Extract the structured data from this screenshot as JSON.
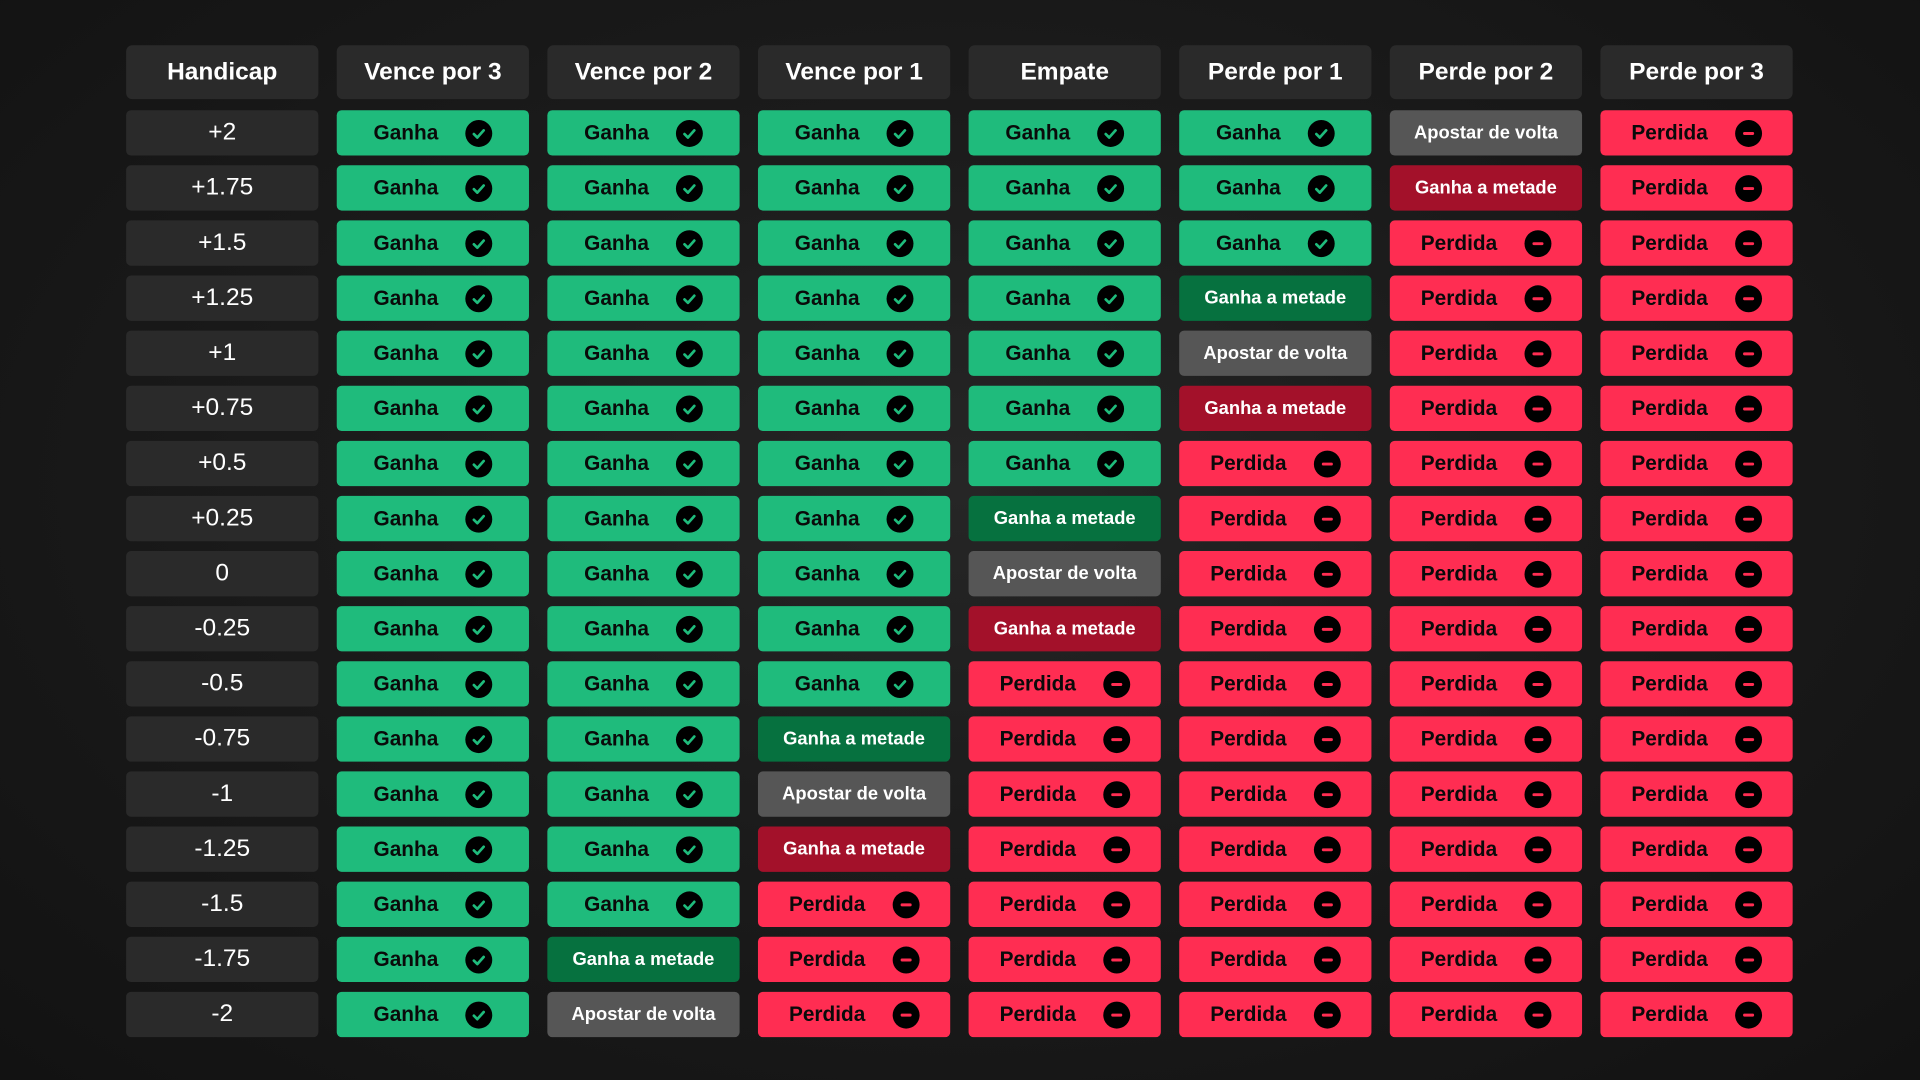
{
  "headers": [
    "Handicap",
    "Vence por 3",
    "Vence por 2",
    "Vence por 1",
    "Empate",
    "Perde por 1",
    "Perde por 2",
    "Perde por 3"
  ],
  "labels": {
    "W": "Ganha",
    "L": "Perdida",
    "HG": "Ganha a metade",
    "HR": "Ganha a metade",
    "P": "Apostar de volta"
  },
  "icons": {
    "W": "check-circle-icon",
    "L": "minus-circle-icon"
  },
  "colors": {
    "win": "#1fbb7c",
    "loss": "#ff2d52",
    "half_win": "#06713f",
    "half_red": "#a3112a",
    "push": "#565656",
    "cell_bg": "#2a2a2a",
    "background": "#151515"
  },
  "rows": [
    {
      "handicap": "+2",
      "results": [
        "W",
        "W",
        "W",
        "W",
        "W",
        "P",
        "L"
      ]
    },
    {
      "handicap": "+1.75",
      "results": [
        "W",
        "W",
        "W",
        "W",
        "W",
        "HR",
        "L"
      ]
    },
    {
      "handicap": "+1.5",
      "results": [
        "W",
        "W",
        "W",
        "W",
        "W",
        "L",
        "L"
      ]
    },
    {
      "handicap": "+1.25",
      "results": [
        "W",
        "W",
        "W",
        "W",
        "HG",
        "L",
        "L"
      ]
    },
    {
      "handicap": "+1",
      "results": [
        "W",
        "W",
        "W",
        "W",
        "P",
        "L",
        "L"
      ]
    },
    {
      "handicap": "+0.75",
      "results": [
        "W",
        "W",
        "W",
        "W",
        "HR",
        "L",
        "L"
      ]
    },
    {
      "handicap": "+0.5",
      "results": [
        "W",
        "W",
        "W",
        "W",
        "L",
        "L",
        "L"
      ]
    },
    {
      "handicap": "+0.25",
      "results": [
        "W",
        "W",
        "W",
        "HG",
        "L",
        "L",
        "L"
      ]
    },
    {
      "handicap": "0",
      "results": [
        "W",
        "W",
        "W",
        "P",
        "L",
        "L",
        "L"
      ]
    },
    {
      "handicap": "-0.25",
      "results": [
        "W",
        "W",
        "W",
        "HR",
        "L",
        "L",
        "L"
      ]
    },
    {
      "handicap": "-0.5",
      "results": [
        "W",
        "W",
        "W",
        "L",
        "L",
        "L",
        "L"
      ]
    },
    {
      "handicap": "-0.75",
      "results": [
        "W",
        "W",
        "HG",
        "L",
        "L",
        "L",
        "L"
      ]
    },
    {
      "handicap": "-1",
      "results": [
        "W",
        "W",
        "P",
        "L",
        "L",
        "L",
        "L"
      ]
    },
    {
      "handicap": "-1.25",
      "results": [
        "W",
        "W",
        "HR",
        "L",
        "L",
        "L",
        "L"
      ]
    },
    {
      "handicap": "-1.5",
      "results": [
        "W",
        "W",
        "L",
        "L",
        "L",
        "L",
        "L"
      ]
    },
    {
      "handicap": "-1.75",
      "results": [
        "W",
        "HG",
        "L",
        "L",
        "L",
        "L",
        "L"
      ]
    },
    {
      "handicap": "-2",
      "results": [
        "W",
        "P",
        "L",
        "L",
        "L",
        "L",
        "L"
      ]
    }
  ]
}
